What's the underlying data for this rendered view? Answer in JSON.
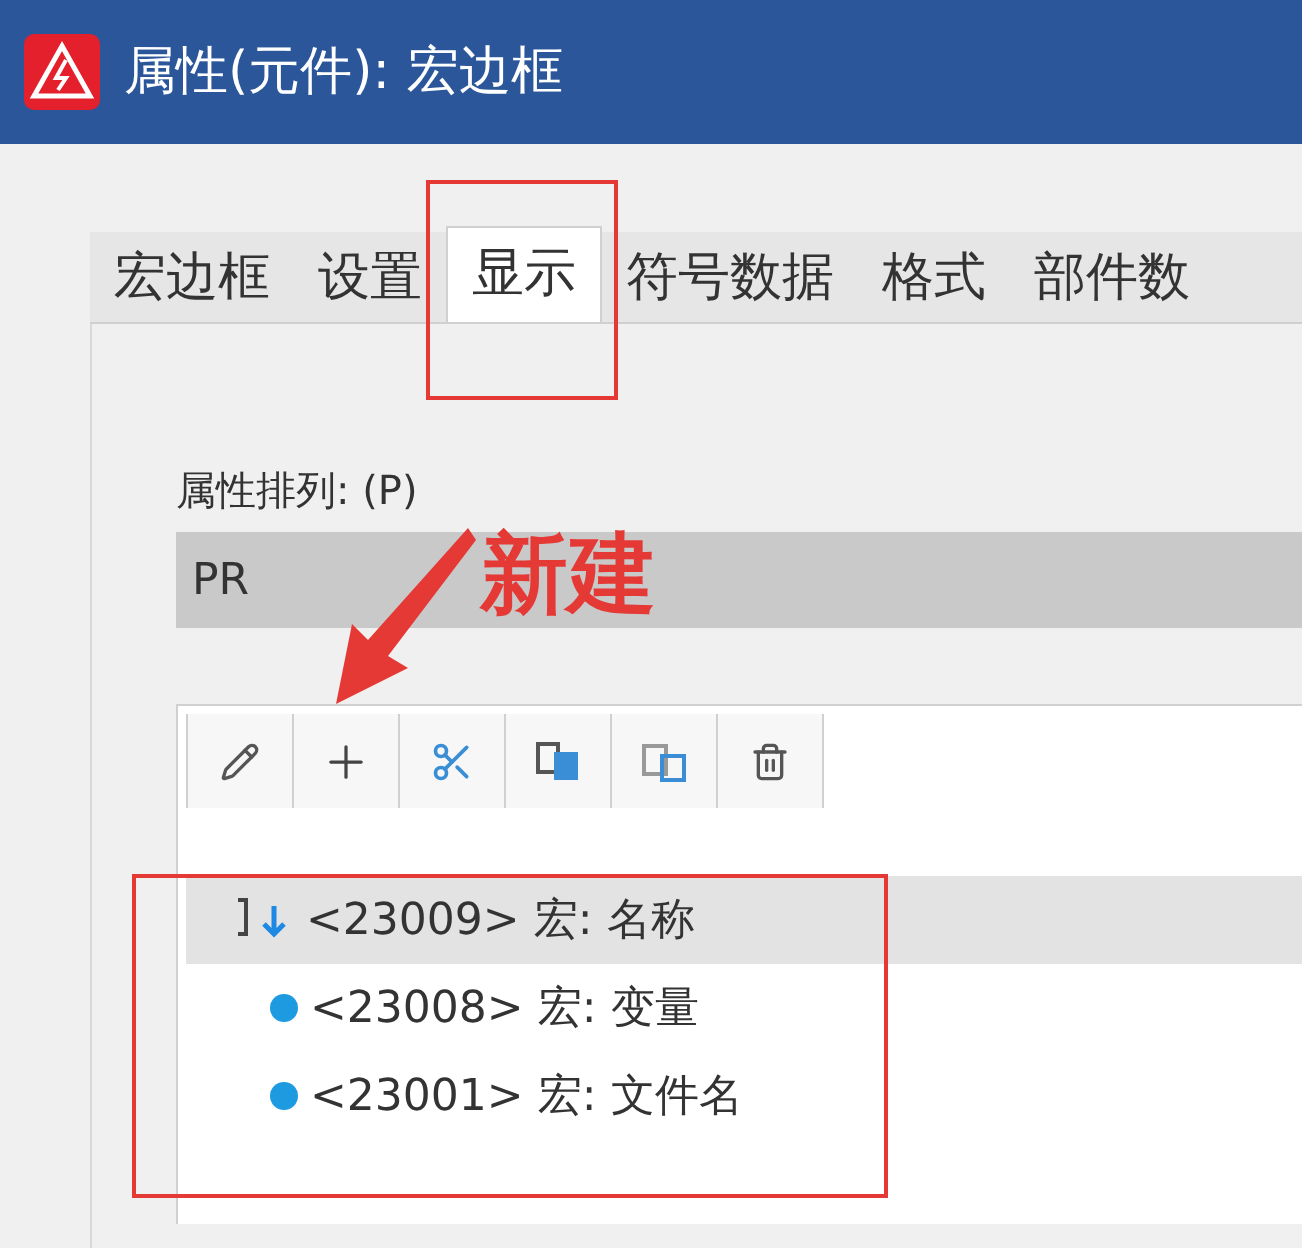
{
  "window": {
    "title": "属性(元件): 宏边框"
  },
  "tabs": [
    {
      "label": "宏边框",
      "selected": false
    },
    {
      "label": "设置",
      "selected": false
    },
    {
      "label": "显示",
      "selected": true
    },
    {
      "label": "符号数据",
      "selected": false
    },
    {
      "label": "格式",
      "selected": false
    },
    {
      "label": "部件数",
      "selected": false
    }
  ],
  "sort_field": {
    "label": "属性排列: (P)",
    "value": "PR"
  },
  "annotation": {
    "text": "新建"
  },
  "list": [
    {
      "kind": "group",
      "text": "<23009> 宏: 名称",
      "selected": true
    },
    {
      "kind": "item",
      "text": "<23008> 宏: 变量",
      "selected": false
    },
    {
      "kind": "item",
      "text": "<23001> 宏: 文件名",
      "selected": false
    }
  ]
}
